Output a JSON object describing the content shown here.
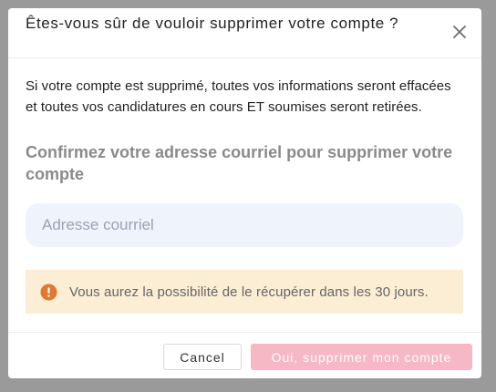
{
  "dialog": {
    "title": "Êtes-vous sûr de vouloir supprimer votre compte ?",
    "close_icon": "close-icon"
  },
  "body": {
    "message": "Si votre compte est supprimé, toutes vos informations seront effacées et toutes vos candidatures en cours ET soumises seront retirées.",
    "confirm_label": "Confirmez votre adresse courriel pour supprimer votre compte",
    "email_input": {
      "value": "",
      "placeholder": "Adresse courriel"
    }
  },
  "warning": {
    "icon": "exclamation-circle-icon",
    "text": "Vous aurez la possibilité de le récupérer dans les 30 jours.",
    "background": "#fbeed5",
    "icon_color": "#e07a32"
  },
  "footer": {
    "cancel_label": "Cancel",
    "delete_label": "Oui, supprimer mon compte",
    "delete_color": "#f6b8c4"
  }
}
